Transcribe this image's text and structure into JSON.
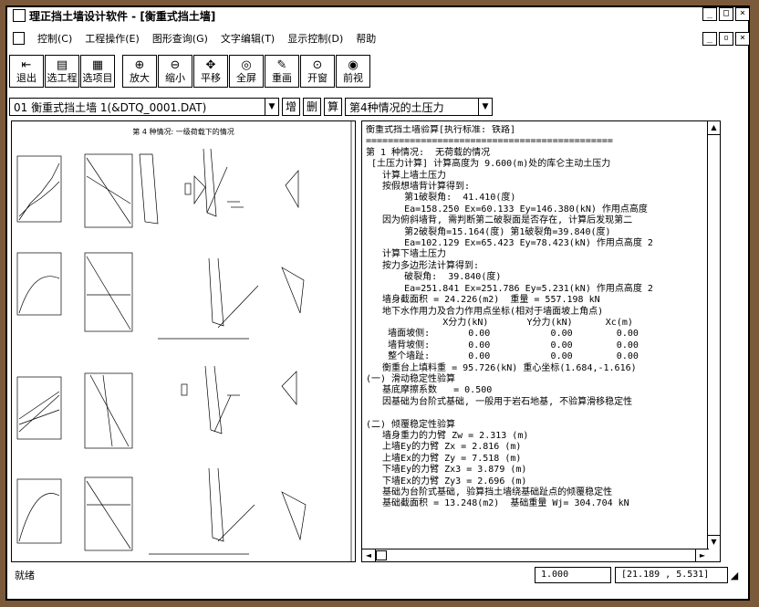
{
  "window": {
    "title": "理正挡土墙设计软件 - [衡重式挡土墙]",
    "min": "_",
    "max": "□",
    "close": "×",
    "restore": "▫"
  },
  "menu": [
    {
      "label": "控制(C)"
    },
    {
      "label": "工程操作(E)"
    },
    {
      "label": "图形查询(G)"
    },
    {
      "label": "文字编辑(T)"
    },
    {
      "label": "显示控制(D)"
    },
    {
      "label": "帮助"
    }
  ],
  "toolbar": [
    {
      "label": "退出",
      "icon": "exit-icon"
    },
    {
      "label": "选工程",
      "icon": "project-icon"
    },
    {
      "label": "选项目",
      "icon": "item-icon"
    },
    {
      "label": "放大",
      "icon": "zoom-in-icon"
    },
    {
      "label": "缩小",
      "icon": "zoom-out-icon"
    },
    {
      "label": "平移",
      "icon": "pan-icon"
    },
    {
      "label": "全屏",
      "icon": "fullscreen-icon"
    },
    {
      "label": "重画",
      "icon": "redraw-icon"
    },
    {
      "label": "开窗",
      "icon": "window-icon"
    },
    {
      "label": "前视",
      "icon": "front-view-icon"
    }
  ],
  "project_select": {
    "value": "01 衡重式挡土墙 1(&DTQ_0001.DAT)"
  },
  "buttons": {
    "add": "增",
    "delete": "删",
    "calc": "算"
  },
  "case_select": {
    "value": "第4种情况的土压力"
  },
  "drawing": {
    "caption": "第 4 种情况: 一级荷载下的情况"
  },
  "report_lines": [
    "衡重式挡土墙验算[执行标准: 铁路]",
    "=============================================",
    "第 1 种情况:  无荷载的情况",
    " [土压力计算] 计算高度为 9.600(m)处的库仑主动土压力",
    "   计算上墙土压力",
    "   按假想墙背计算得到:",
    "       第1破裂角:  41.410(度)",
    "       Ea=158.250 Ex=60.133 Ey=146.380(kN) 作用点高度",
    "   因为俯斜墙背, 需判断第二破裂面是否存在, 计算后发现第二",
    "       第2破裂角=15.164(度) 第1破裂角=39.840(度)",
    "       Ea=102.129 Ex=65.423 Ey=78.423(kN) 作用点高度 2",
    "   计算下墙土压力",
    "   按力多边形法计算得到:",
    "       破裂角:  39.840(度)",
    "       Ea=251.841 Ex=251.786 Ey=5.231(kN) 作用点高度 2",
    "   墙身截面积 = 24.226(m2)  重量 = 557.198 kN",
    "   地下水作用力及合力作用点坐标(相对于墙面坡上角点)",
    "              X分力(kN)       Y分力(kN)      Xc(m)",
    "    墙面坡侧:       0.00           0.00        0.00",
    "    墙背坡侧:       0.00           0.00        0.00",
    "    整个墙趾:       0.00           0.00        0.00",
    "   衡重台上填料重 = 95.726(kN) 重心坐标(1.684,-1.616)",
    "(一) 滑动稳定性验算",
    "   基底摩擦系数   = 0.500",
    "   因基础为台阶式基础, 一般用于岩石地基, 不验算滑移稳定性",
    "",
    "(二) 倾覆稳定性验算",
    "   墙身重力的力臂 Zw = 2.313 (m)",
    "   上墙Ey的力臂 Zx = 2.816 (m)",
    "   上墙Ex的力臂 Zy = 7.518 (m)",
    "   下墙Ey的力臂 Zx3 = 3.879 (m)",
    "   下墙Ex的力臂 Zy3 = 2.696 (m)",
    "   基础为台阶式基础, 验算挡土墙绕基础趾点的倾覆稳定性",
    "   基础截面积 = 13.248(m2)  基础重量 Wj= 304.704 kN"
  ],
  "status": {
    "text": "就绪",
    "scale": "1.000",
    "coords": "[21.189 , 5.531]"
  }
}
